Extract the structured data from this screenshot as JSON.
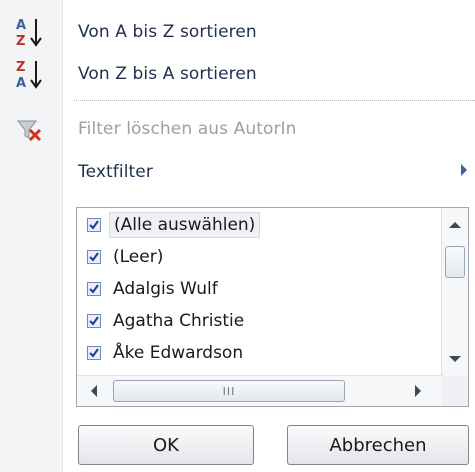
{
  "menu": {
    "sort_az": {
      "label": "Von A bis Z sortieren",
      "icon": "sort-ascending-icon"
    },
    "sort_za": {
      "label": "Von Z bis A sortieren",
      "icon": "sort-descending-icon"
    },
    "clear_filter": {
      "label": "Filter löschen aus AutorIn",
      "icon": "clear-filter-icon",
      "disabled": true
    },
    "text_filter": {
      "label": "Textfilter",
      "has_submenu": true
    }
  },
  "list": {
    "items": [
      {
        "label": "(Alle auswählen)",
        "checked": true,
        "selected": true
      },
      {
        "label": "(Leer)",
        "checked": true
      },
      {
        "label": "Adalgis Wulf",
        "checked": true
      },
      {
        "label": "Agatha Christie",
        "checked": true
      },
      {
        "label": "Åke Edwardson",
        "checked": true
      }
    ],
    "hscroll_grip": "III"
  },
  "buttons": {
    "ok": "OK",
    "cancel": "Abbrechen"
  },
  "colors": {
    "menu_text": "#1e2f4e",
    "disabled_text": "#9aa0a8",
    "accent": "#3b5fa0",
    "clear_filter_red": "#d03020"
  }
}
